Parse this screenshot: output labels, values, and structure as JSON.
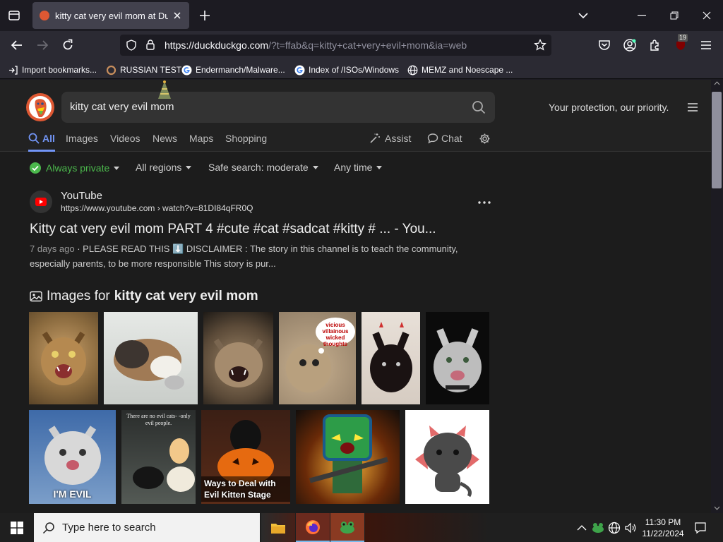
{
  "browser": {
    "tab_title": "kitty cat very evil mom at DuckDuckGo",
    "new_tab_icon": "plus-icon",
    "url_host": "https://duckduckgo.com",
    "url_rest": "/?t=ffab&q=kitty+cat+very+evil+mom&ia=web",
    "extension_badge": "19",
    "bookmarks": [
      {
        "label": "Import bookmarks...",
        "icon": "import-icon"
      },
      {
        "label": "RUSSIAN TEST",
        "icon": "search-icon"
      },
      {
        "label": "Endermanch/Malware...",
        "icon": "google-icon"
      },
      {
        "label": "Index of /ISOs/Windows",
        "icon": "google-icon"
      },
      {
        "label": "MEMZ and Noescape ...",
        "icon": "globe-icon"
      }
    ]
  },
  "ddg": {
    "query": "kitty cat very evil mom",
    "protection_text": "Your protection, our priority.",
    "tabs": [
      "All",
      "Images",
      "Videos",
      "News",
      "Maps",
      "Shopping"
    ],
    "assist_label": "Assist",
    "chat_label": "Chat",
    "filters": {
      "private": "Always private",
      "region": "All regions",
      "safe_search": "Safe search: moderate",
      "time": "Any time"
    },
    "result": {
      "site": "YouTube",
      "url": "https://www.youtube.com › watch?v=81DI84qFR0Q",
      "title": "Kitty cat very evil mom PART 4 #cute #cat #sadcat #kitty # ... - You...",
      "date": "7 days ago",
      "snippet": "· PLEASE READ THIS ⬇️ DISCLAIMER : The story in this channel is to teach the community, especially parents, to be more responsible This story is pur..."
    },
    "images_heading_prefix": "Images for",
    "images_heading_query": "kitty cat very evil mom",
    "thumbnails": [
      {
        "caption": ""
      },
      {
        "caption": ""
      },
      {
        "caption": ""
      },
      {
        "caption": "vicious villainous wicked thoughts"
      },
      {
        "caption": ""
      },
      {
        "caption": ""
      },
      {
        "caption": "I'M EVIL"
      },
      {
        "caption": "There are no evil cats- -only evil people."
      },
      {
        "caption": "Ways to Deal with Evil Kitten Stage"
      },
      {
        "caption": ""
      },
      {
        "caption": ""
      }
    ]
  },
  "taskbar": {
    "search_placeholder": "Type here to search",
    "time": "11:30 PM",
    "date": "11/22/2024"
  },
  "colors": {
    "accent": "#7295f6",
    "private_green": "#4bb84c",
    "ddg_orange": "#de5833"
  }
}
